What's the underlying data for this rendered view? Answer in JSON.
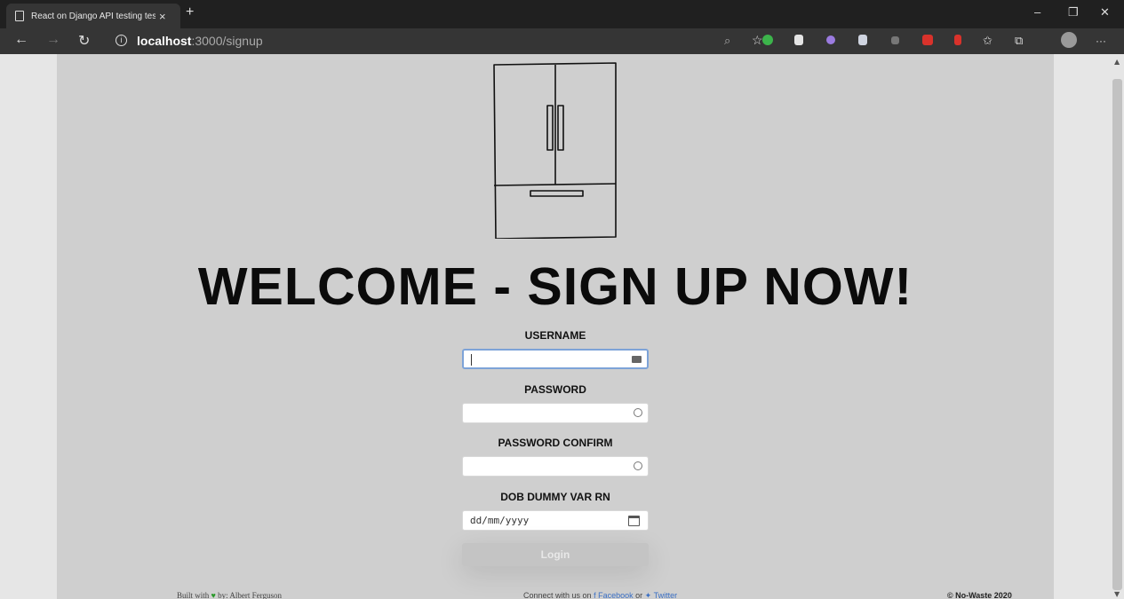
{
  "browser": {
    "tab_title": "React on Django API testing test",
    "tab_close": "×",
    "new_tab": "+",
    "window_controls": {
      "minimize": "–",
      "restore": "❐",
      "close": "✕"
    },
    "nav": {
      "back": "←",
      "forward": "→",
      "reload": "↻"
    },
    "url_host": "localhost",
    "url_rest": ":3000/signup",
    "more": "···"
  },
  "page": {
    "headline": "WELCOME - SIGN UP NOW!",
    "fields": {
      "username": {
        "label": "USERNAME",
        "value": ""
      },
      "password": {
        "label": "PASSWORD",
        "value": ""
      },
      "password_confirm": {
        "label": "PASSWORD CONFIRM",
        "value": ""
      },
      "dob": {
        "label": "DOB DUMMY VAR RN",
        "placeholder": "dd/mm/yyyy"
      }
    },
    "login_button": "Login",
    "footer": {
      "built_prefix": "Built with",
      "built_suffix": "by: Albert Ferguson",
      "connect_prefix": "Connect with us on",
      "facebook": "Facebook",
      "or": "or",
      "twitter": "Twitter",
      "copyright": "© No-Waste 2020"
    }
  },
  "colors": {
    "page_bg": "#cfcfcf",
    "link": "#3a6fc4",
    "heart": "#2a9a2a",
    "focus_border": "#7da3d8"
  }
}
